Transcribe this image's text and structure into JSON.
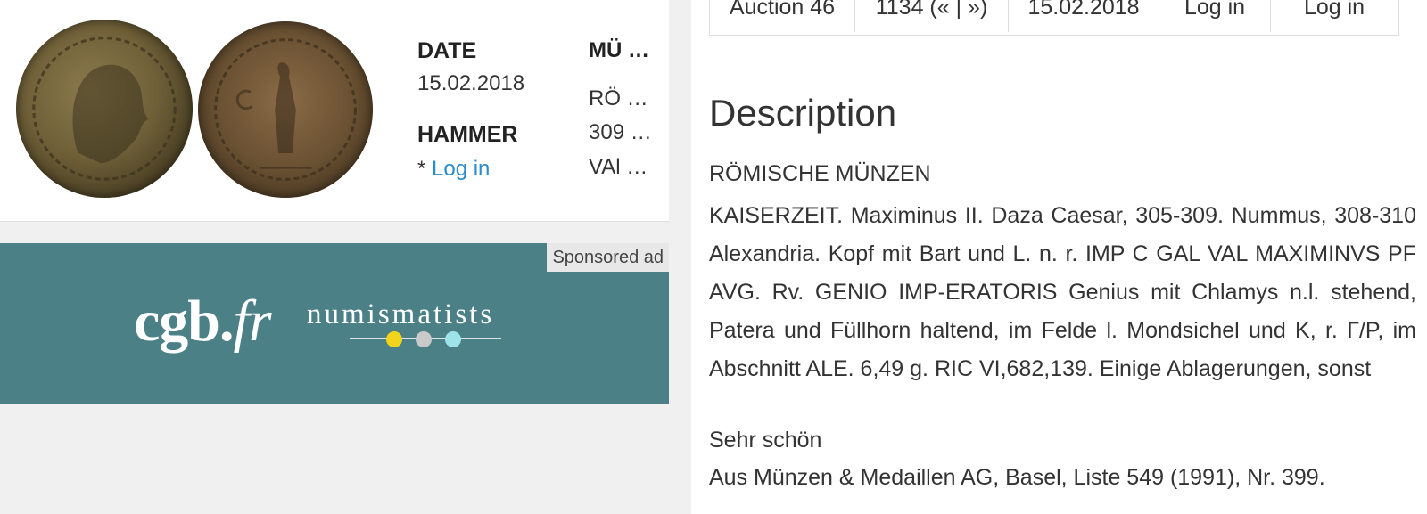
{
  "lot": {
    "date_label": "DATE",
    "date_value": "15.02.2018",
    "hammer_label": "HAMMER",
    "hammer_prefix": "* ",
    "hammer_link": "Log in",
    "col2_header": "MÜ …",
    "col2_values": [
      "RÖ …",
      "309 …",
      "VAl …"
    ]
  },
  "ad": {
    "tag": "Sponsored ad",
    "logo_main": "cgb.",
    "logo_italic": "fr",
    "logo_sub": "numismatists",
    "dot_colors": [
      "#f2d41c",
      "#c9c9c9",
      "#9fe3ea"
    ]
  },
  "auction_table": {
    "cells": [
      "Auction 46",
      "1134 (« | »)",
      "15.02.2018",
      "Log in",
      "Log in"
    ]
  },
  "description": {
    "title": "Description",
    "category": "RÖMISCHE MÜNZEN",
    "body": "KAISERZEIT. Maximinus II. Daza Caesar, 305-309. Nummus, 308-310 Alexandria. Kopf mit Bart und L. n. r. IMP C GAL VAL MAXIMINVS PF AVG. Rv. GENIO IMP-ERATORIS Genius mit Chlamys n.l. stehend, Patera und Füllhorn haltend, im Felde l. Mondsichel und K, r. Γ/P, im Abschnitt ALE. 6,49 g. RIC VI,682,139. Einige Ablagerungen, sonst",
    "grade": "Sehr schön",
    "provenance": "Aus Münzen & Medaillen AG, Basel, Liste 549 (1991), Nr. 399."
  }
}
